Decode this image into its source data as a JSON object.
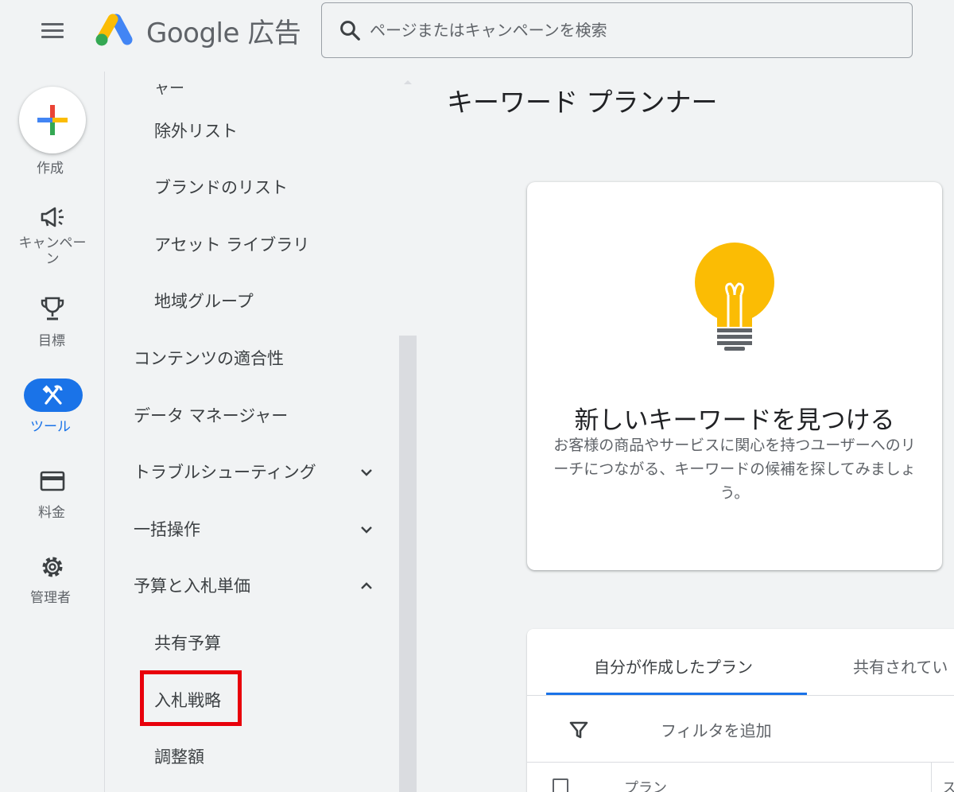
{
  "header": {
    "logo_text": "Google 広告",
    "search_placeholder": "ページまたはキャンペーンを検索"
  },
  "rail": {
    "create_label": "作成",
    "campaigns_label": "キャンペーン",
    "goals_label": "目標",
    "tools_label": "ツール",
    "billing_label": "料金",
    "admin_label": "管理者"
  },
  "nav": {
    "clipped_item": "ャー",
    "exclusion_lists": "除外リスト",
    "brand_lists": "ブランドのリスト",
    "asset_library": "アセット ライブラリ",
    "location_groups": "地域グループ",
    "content_suitability": "コンテンツの適合性",
    "data_manager": "データ マネージャー",
    "troubleshooting": "トラブルシューティング",
    "bulk_actions": "一括操作",
    "budgets_and_bidding": "予算と入札単価",
    "shared_budgets": "共有予算",
    "bid_strategies": "入札戦略",
    "bid_adjustments": "調整額"
  },
  "main": {
    "page_title": "キーワード プランナー",
    "card_title": "新しいキーワードを見つける",
    "card_desc": "お客様の商品やサービスに関心を持つユーザーへのリーチにつながる、キーワードの候補を探してみましょう。",
    "tab_my_plans": "自分が作成したプラン",
    "tab_shared": "共有されてい",
    "filter_label": "フィルタを追加",
    "col_plan": "プラン",
    "col_next": "ス"
  },
  "colors": {
    "accent": "#1a73e8",
    "highlight": "#e8000b",
    "bulb": "#fbbc04"
  }
}
